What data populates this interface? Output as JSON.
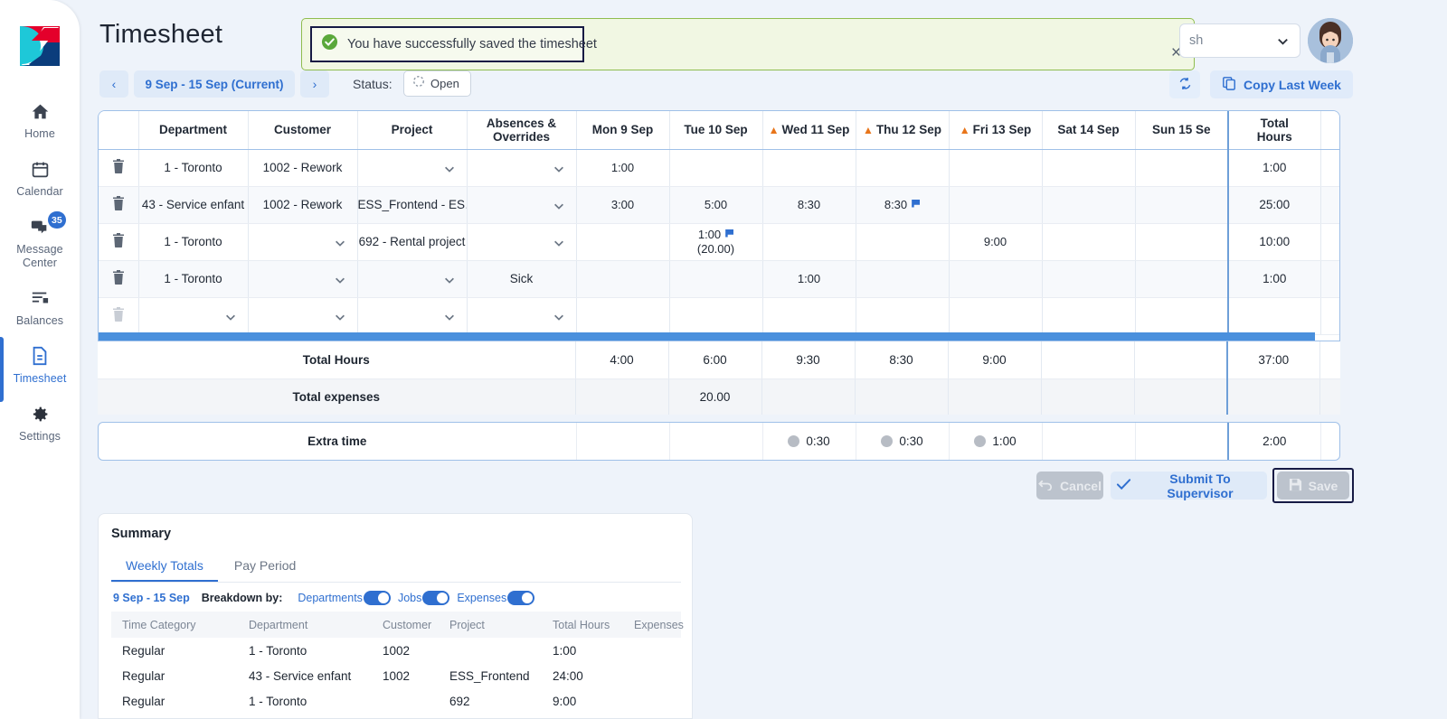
{
  "app": {
    "page_title": "Timesheet",
    "language_value": "sh",
    "avatar": "user-avatar"
  },
  "toast": {
    "message": "You have successfully saved the timesheet",
    "close_label": "×",
    "icon": "check-circle-icon",
    "border_color": "#8fbd4e",
    "bg_color": "#f1f7e3"
  },
  "sidebar": {
    "items": [
      {
        "label": "Home",
        "icon": "home-icon",
        "active": false,
        "badge": ""
      },
      {
        "label": "Calendar",
        "icon": "calendar-icon",
        "active": false,
        "badge": ""
      },
      {
        "label": "Message Center",
        "icon": "message-icon",
        "active": false,
        "badge": "35"
      },
      {
        "label": "Balances",
        "icon": "balances-icon",
        "active": false,
        "badge": ""
      },
      {
        "label": "Timesheet",
        "icon": "document-icon",
        "active": true,
        "badge": ""
      },
      {
        "label": "Settings",
        "icon": "gear-icon",
        "active": false,
        "badge": ""
      }
    ]
  },
  "periodbar": {
    "prev_label": "‹",
    "period_label": "9 Sep - 15 Sep (Current)",
    "next_label": "›",
    "status_label": "Status:",
    "status_value": "Open",
    "refresh_icon": "refresh-icon",
    "copy_last_week": "Copy Last Week",
    "copy_icon": "copy-icon"
  },
  "grid": {
    "columns": [
      {
        "key": "trash",
        "label": "",
        "warn": false
      },
      {
        "key": "dept",
        "label": "Department",
        "warn": false
      },
      {
        "key": "cust",
        "label": "Customer",
        "warn": false
      },
      {
        "key": "proj",
        "label": "Project",
        "warn": false
      },
      {
        "key": "abs",
        "label": "Absences & Overrides",
        "warn": false
      },
      {
        "key": "mon",
        "label": "Mon 9 Sep",
        "warn": false
      },
      {
        "key": "tue",
        "label": "Tue 10 Sep",
        "warn": false
      },
      {
        "key": "wed",
        "label": "Wed 11 Sep",
        "warn": true
      },
      {
        "key": "thu",
        "label": "Thu 12 Sep",
        "warn": true
      },
      {
        "key": "fri",
        "label": "Fri 13 Sep",
        "warn": true
      },
      {
        "key": "sat",
        "label": "Sat 14 Sep",
        "warn": false
      },
      {
        "key": "sun",
        "label": "Sun 15 Se",
        "warn": false
      },
      {
        "key": "th",
        "label": "Total Hours",
        "warn": false
      },
      {
        "key": "te",
        "label": "Total expenses",
        "warn": false
      }
    ],
    "rows": [
      {
        "dept": "1 - Toronto",
        "dept_select": false,
        "cust": "1002 - Rework",
        "cust_select": false,
        "proj": "",
        "proj_select": true,
        "abs": "",
        "abs_select": true,
        "mon": "1:00",
        "tue": "",
        "wed": "",
        "thu": "",
        "fri": "",
        "sat": "",
        "sun": "",
        "mon_flag": false,
        "tue_flag": false,
        "wed_flag": false,
        "thu_flag": false,
        "tue_sub": "",
        "total_hours": "1:00",
        "total_expenses": "",
        "deletable": true
      },
      {
        "dept": "43 - Service enfant",
        "dept_select": false,
        "cust": "1002 - Rework",
        "cust_select": false,
        "proj": "ESS_Frontend - ES…",
        "proj_select": false,
        "abs": "",
        "abs_select": true,
        "mon": "3:00",
        "tue": "5:00",
        "wed": "8:30",
        "thu": "8:30",
        "fri": "",
        "sat": "",
        "sun": "",
        "mon_flag": false,
        "tue_flag": false,
        "wed_flag": false,
        "thu_flag": true,
        "tue_sub": "",
        "total_hours": "25:00",
        "total_expenses": "",
        "deletable": true
      },
      {
        "dept": "1 - Toronto",
        "dept_select": false,
        "cust": "",
        "cust_select": true,
        "proj": "692 - Rental project",
        "proj_select": false,
        "abs": "",
        "abs_select": true,
        "mon": "",
        "tue": "1:00",
        "wed": "",
        "thu": "",
        "fri": "9:00",
        "sat": "",
        "sun": "",
        "mon_flag": false,
        "tue_flag": true,
        "wed_flag": false,
        "thu_flag": false,
        "tue_sub": "(20.00)",
        "total_hours": "10:00",
        "total_expenses": "20.00",
        "deletable": true
      },
      {
        "dept": "1 - Toronto",
        "dept_select": false,
        "cust": "",
        "cust_select": true,
        "proj": "",
        "proj_select": true,
        "abs": "Sick",
        "abs_select": false,
        "mon": "",
        "tue": "",
        "wed": "1:00",
        "thu": "",
        "fri": "",
        "sat": "",
        "sun": "",
        "mon_flag": false,
        "tue_flag": false,
        "wed_flag": false,
        "thu_flag": false,
        "tue_sub": "",
        "total_hours": "1:00",
        "total_expenses": "",
        "deletable": true
      },
      {
        "dept": "",
        "dept_select": true,
        "cust": "",
        "cust_select": true,
        "proj": "",
        "proj_select": true,
        "abs": "",
        "abs_select": true,
        "mon": "",
        "tue": "",
        "wed": "",
        "thu": "",
        "fri": "",
        "sat": "",
        "sun": "",
        "mon_flag": false,
        "tue_flag": false,
        "wed_flag": false,
        "thu_flag": false,
        "tue_sub": "",
        "total_hours": "",
        "total_expenses": "",
        "deletable": false
      }
    ],
    "totals": {
      "hours_label": "Total Hours",
      "hours": {
        "mon": "4:00",
        "tue": "6:00",
        "wed": "9:30",
        "thu": "8:30",
        "fri": "9:00",
        "sat": "",
        "sun": "",
        "total": "37:00",
        "expenses": ""
      },
      "expenses_label": "Total expenses",
      "expenses": {
        "mon": "",
        "tue": "20.00",
        "wed": "",
        "thu": "",
        "fri": "",
        "sat": "",
        "sun": "",
        "total": "",
        "expenses": "20.00"
      }
    },
    "extra": {
      "label": "Extra time",
      "cells": {
        "mon": "",
        "tue": "",
        "wed": "0:30",
        "thu": "0:30",
        "fri": "1:00",
        "sat": "",
        "sun": "",
        "total": "2:00",
        "expenses": ""
      },
      "dots": {
        "wed": true,
        "thu": true,
        "fri": true
      }
    }
  },
  "actions": {
    "cancel": "Cancel",
    "cancel_icon": "undo-icon",
    "submit": "Submit To Supervisor",
    "submit_icon": "check-icon",
    "save": "Save",
    "save_icon": "floppy-disk-icon"
  },
  "summary": {
    "title": "Summary",
    "tabs": [
      {
        "label": "Weekly Totals",
        "active": true
      },
      {
        "label": "Pay Period",
        "active": false
      }
    ],
    "period": "9 Sep - 15 Sep",
    "breakdown_label": "Breakdown by:",
    "toggles": [
      {
        "label": "Departments",
        "on": true
      },
      {
        "label": "Jobs",
        "on": true
      },
      {
        "label": "Expenses",
        "on": true
      }
    ],
    "columns": [
      "Time Category",
      "Department",
      "Customer",
      "Project",
      "Total Hours",
      "Expenses"
    ],
    "rows": [
      {
        "cat": "Regular",
        "dept": "1 - Toronto",
        "cust": "1002",
        "proj": "",
        "hours": "1:00",
        "exp": ""
      },
      {
        "cat": "Regular",
        "dept": "43 - Service enfant",
        "cust": "1002",
        "proj": "ESS_Frontend",
        "hours": "24:00",
        "exp": ""
      },
      {
        "cat": "Regular",
        "dept": "1 - Toronto",
        "cust": "",
        "proj": "692",
        "hours": "9:00",
        "exp": ""
      }
    ]
  }
}
